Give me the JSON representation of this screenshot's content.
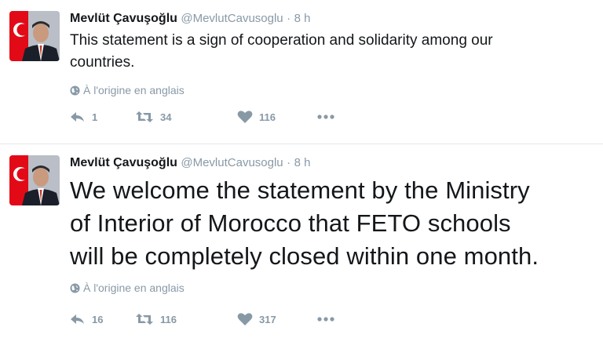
{
  "tweets": [
    {
      "author_name": "Mevlüt Çavuşoğlu",
      "handle": "@MevlutCavusoglu",
      "separator": "·",
      "time": "8 h",
      "text_lines": [
        "This statement is a sign of cooperation and solidarity among our",
        "countries."
      ],
      "translate_label": "À l'origine en anglais",
      "actions": {
        "reply_count": "1",
        "retweet_count": "34",
        "like_count": "116"
      }
    },
    {
      "author_name": "Mevlüt Çavuşoğlu",
      "handle": "@MevlutCavusoglu",
      "separator": "·",
      "time": "8 h",
      "text_lines": [
        "We welcome the statement by the Ministry",
        "of Interior of Morocco that FETO schools",
        "will be completely closed within one month."
      ],
      "translate_label": "À l'origine en anglais",
      "actions": {
        "reply_count": "16",
        "retweet_count": "116",
        "like_count": "317"
      }
    }
  ],
  "colors": {
    "text": "#14171a",
    "muted": "#8899a6",
    "divider": "#e1e8ed",
    "flag_red": "#e30a17"
  },
  "icons": [
    "avatar-photo",
    "globe-icon",
    "reply-icon",
    "retweet-icon",
    "heart-icon",
    "more-icon"
  ]
}
